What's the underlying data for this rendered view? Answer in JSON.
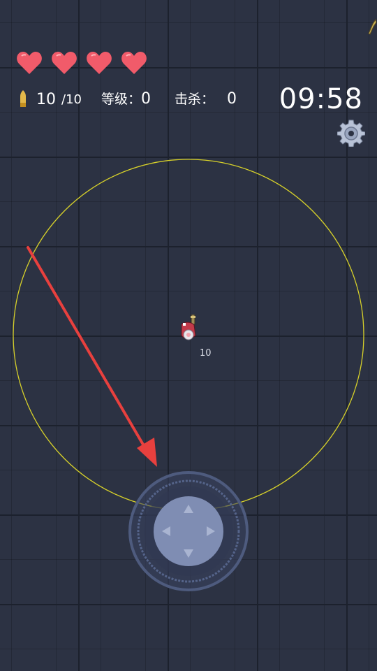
{
  "hud": {
    "hearts": [
      {
        "icon": "heart-icon"
      },
      {
        "icon": "heart-icon"
      },
      {
        "icon": "heart-icon"
      },
      {
        "icon": "heart-icon"
      }
    ],
    "ammo_current": "10",
    "ammo_max": "/10",
    "level_label": "等级：",
    "level_value": "0",
    "kills_label": "击杀：",
    "kills_value": "0",
    "timer": "09:58"
  },
  "player": {
    "ammo_text": "10"
  },
  "icons": {
    "bullet": "bullet-icon",
    "settings": "gear-icon",
    "corner": "sword-icon",
    "joystick": "dpad-icon",
    "hint": "swipe-arrow-icon"
  },
  "colors": {
    "heart": "#f15b6a",
    "range_circle": "#d7d12a",
    "arrow": "#e8403e",
    "timer": "#ffffff",
    "joystick_inner": "#7f8db3",
    "floor": "#2c3243"
  }
}
